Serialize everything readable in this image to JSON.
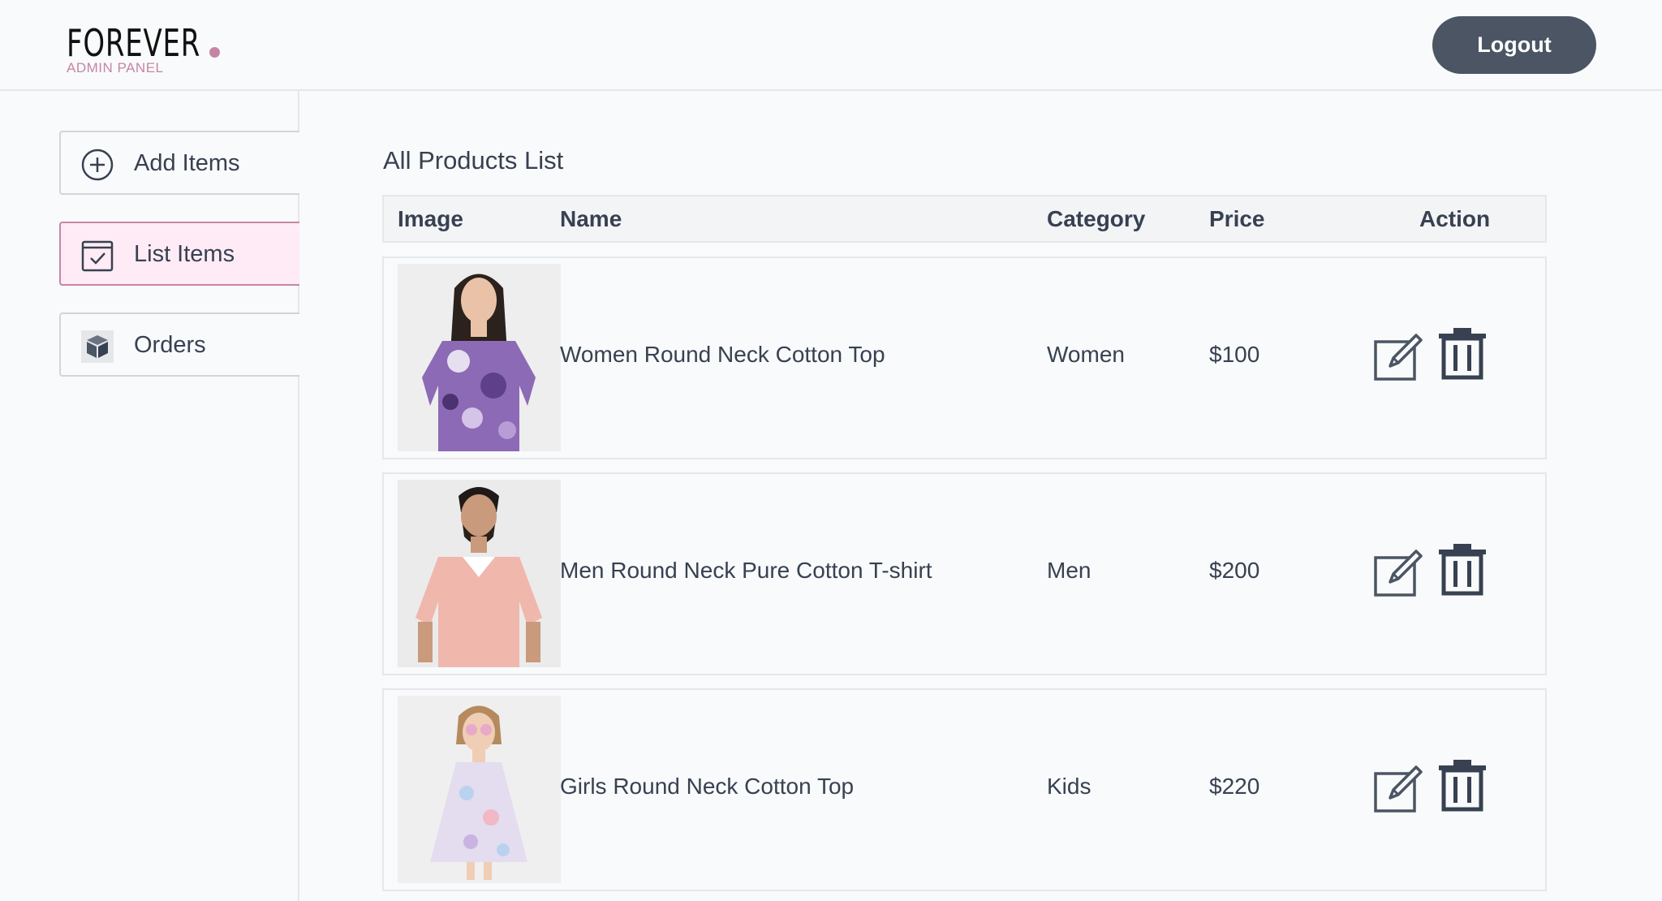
{
  "brand": {
    "name": "FOREVER",
    "subtitle": "ADMIN PANEL",
    "accent_color": "#c586a5"
  },
  "header": {
    "logout_label": "Logout"
  },
  "sidebar": {
    "items": [
      {
        "label": "Add Items",
        "icon": "plus-circle-icon",
        "active": false
      },
      {
        "label": "List Items",
        "icon": "checklist-icon",
        "active": true
      },
      {
        "label": "Orders",
        "icon": "package-icon",
        "active": false
      }
    ]
  },
  "main": {
    "title": "All Products List",
    "columns": [
      "Image",
      "Name",
      "Category",
      "Price",
      "Action"
    ],
    "products": [
      {
        "name": "Women Round Neck Cotton Top",
        "category": "Women",
        "price": "$100"
      },
      {
        "name": "Men Round Neck Pure Cotton T-shirt",
        "category": "Men",
        "price": "$200"
      },
      {
        "name": "Girls Round Neck Cotton Top",
        "category": "Kids",
        "price": "$220"
      }
    ]
  }
}
